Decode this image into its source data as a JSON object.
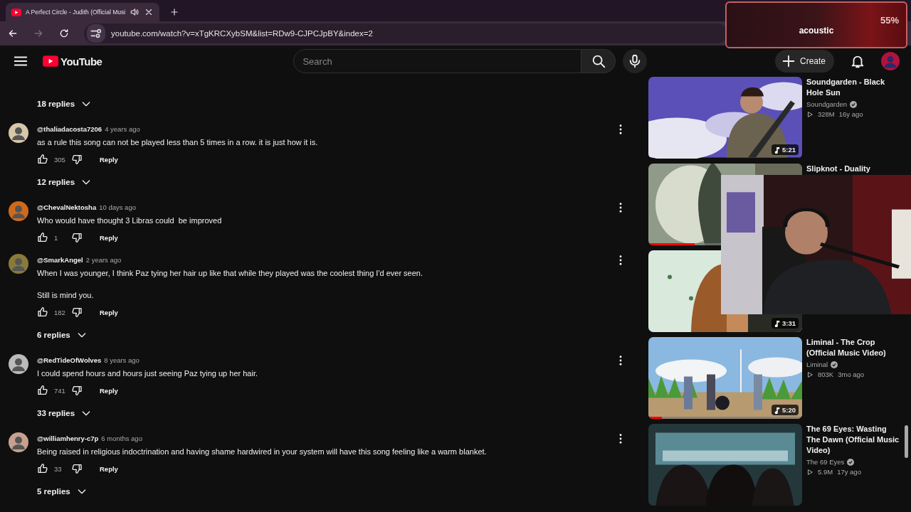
{
  "browser": {
    "tab": {
      "title": "A Perfect Circle - Judith (Official Musi"
    },
    "address": "youtube.com/watch?v=xTgKRCXybSM&list=RDw9-CJPCJpBY&index=2"
  },
  "header": {
    "logo": "YouTube",
    "search": {
      "placeholder": "Search"
    },
    "create": "Create"
  },
  "comments": {
    "leading_replies": "18 replies",
    "items": [
      {
        "author": "@thaliadacosta7206",
        "time": "4 years ago",
        "paragraphs": [
          "as a rule this song can not be played less than 5 times in a row. it is just how it is."
        ],
        "likes": "305",
        "reply": "Reply",
        "replies": "12 replies"
      },
      {
        "author": "@ChevalNektosha",
        "time": "10 days ago",
        "paragraphs": [
          "Who would have thought 3 Libras could  be improved"
        ],
        "likes": "1",
        "reply": "Reply"
      },
      {
        "author": "@SmarkAngel",
        "time": "2 years ago",
        "paragraphs": [
          "When I was younger, I think Paz tying her hair up like that while they played was the coolest thing I'd ever seen.",
          "Still is mind you."
        ],
        "likes": "182",
        "reply": "Reply",
        "replies": "6 replies"
      },
      {
        "author": "@RedTideOfWolves",
        "time": "8 years ago",
        "paragraphs": [
          "I could spend hours and hours just seeing Paz tying up her hair."
        ],
        "likes": "741",
        "reply": "Reply",
        "replies": "33 replies"
      },
      {
        "author": "@williamhenry-c7p",
        "time": "6 months ago",
        "paragraphs": [
          "Being raised in religious indoctrination and having shame hardwired in your system will have this song feeling like a warm blanket."
        ],
        "likes": "33",
        "reply": "Reply",
        "replies": "5 replies"
      }
    ]
  },
  "up_next": [
    {
      "title": "Soundgarden - Black Hole Sun",
      "channel": "Soundgarden",
      "verified": true,
      "views": "328M",
      "age": "16y ago",
      "duration": "5:21"
    },
    {
      "title": "Slipknot - Duality",
      "progress": {
        "level": 0.3
      }
    },
    {
      "duration": "3:31"
    },
    {
      "title": "Liminal - The Crop (Official Music Video)",
      "channel": "Liminal",
      "verified": true,
      "views": "803K",
      "age": "3mo ago",
      "duration": "5:20",
      "progress": {
        "level": 0.09
      }
    },
    {
      "title": "The 69 Eyes: Wasting The Dawn (Official Music Video)",
      "channel": "The 69 Eyes",
      "verified": true,
      "views": "5.9M",
      "age": "17y ago"
    }
  ],
  "overlay": {
    "reading": "55%",
    "label": "acoustic"
  }
}
